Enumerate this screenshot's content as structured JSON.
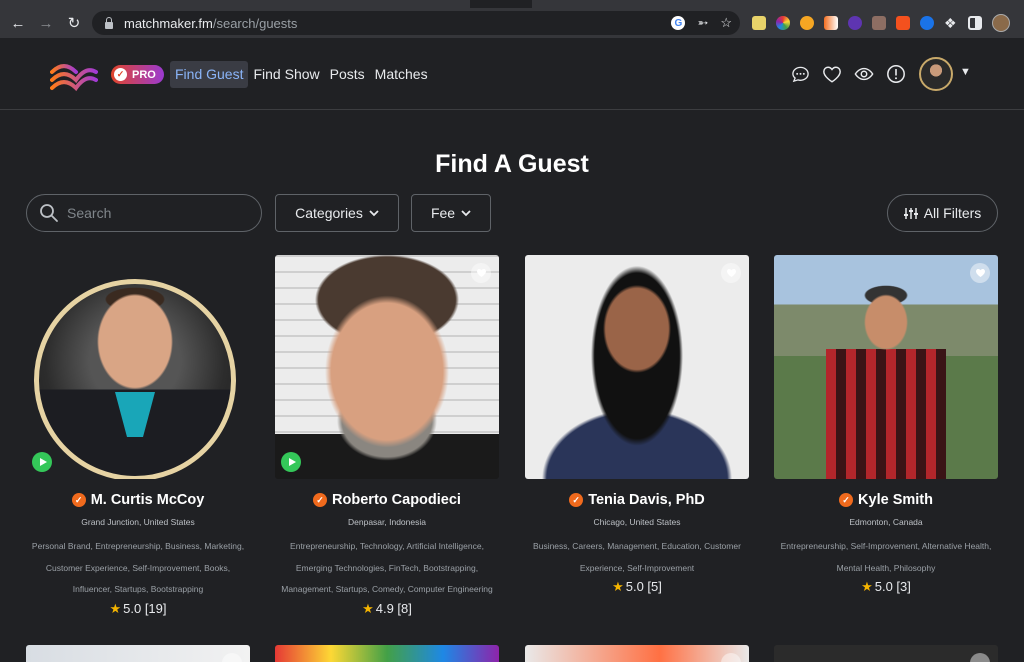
{
  "browser": {
    "url_host": "matchmaker.fm",
    "url_path": "/search/guests"
  },
  "header": {
    "badge_label": "PRO",
    "nav": [
      {
        "label": "Find Guest",
        "active": true
      },
      {
        "label": "Find Show",
        "active": false
      },
      {
        "label": "Posts",
        "active": false
      },
      {
        "label": "Matches",
        "active": false
      }
    ],
    "icons": [
      "chat-icon",
      "heart-icon",
      "eye-icon",
      "alert-icon"
    ]
  },
  "main": {
    "title": "Find A Guest",
    "search_placeholder": "Search",
    "categories_label": "Categories",
    "fee_label": "Fee",
    "all_filters_label": "All Filters"
  },
  "guests": [
    {
      "name": "M. Curtis McCoy",
      "location": "Grand Junction, United States",
      "categories": "Personal Brand, Entrepreneurship, Business, Marketing, Customer Experience, Self-Improvement, Books, Influencer, Startups, Bootstrapping",
      "rating": "5.0 [19]"
    },
    {
      "name": "Roberto Capodieci",
      "location": "Denpasar, Indonesia",
      "categories": "Entrepreneurship, Technology, Artificial Intelligence, Emerging Technologies, FinTech, Bootstrapping, Management, Startups, Comedy, Computer Engineering",
      "rating": "4.9 [8]"
    },
    {
      "name": "Tenia Davis, PhD",
      "location": "Chicago, United States",
      "categories": "Business, Careers, Management, Education, Customer Experience, Self-Improvement",
      "rating": "5.0 [5]"
    },
    {
      "name": "Kyle Smith",
      "location": "Edmonton, Canada",
      "categories": "Entrepreneurship, Self-Improvement, Alternative Health, Mental Health, Philosophy",
      "rating": "5.0 [3]"
    }
  ],
  "colors": {
    "accent_orange": "#f06a1d",
    "nav_active": "#8ab4f8",
    "play_green": "#34c759",
    "star": "#f4b400"
  }
}
